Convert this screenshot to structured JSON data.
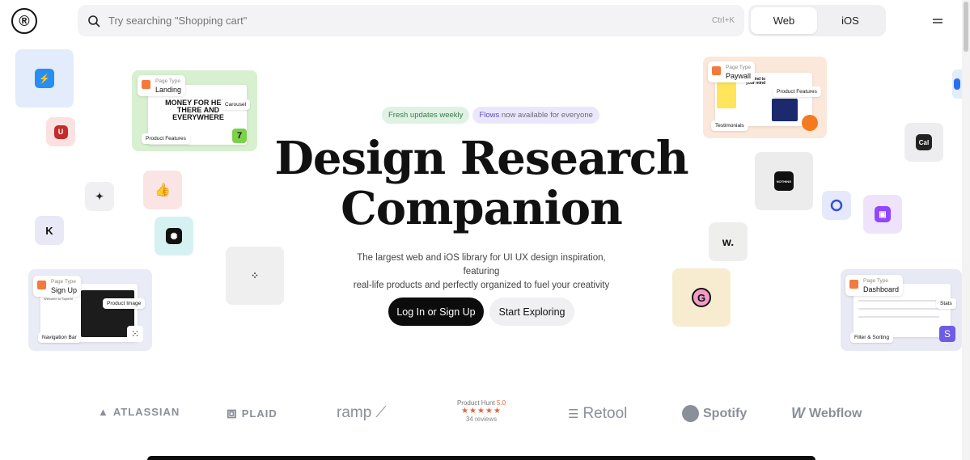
{
  "header": {
    "logo": "®",
    "search_placeholder": "Try searching \"Shopping cart\"",
    "search_shortcut": "Ctrl+K",
    "platform_tabs": [
      {
        "label": "Web",
        "active": true
      },
      {
        "label": "iOS",
        "active": false
      }
    ]
  },
  "hero": {
    "pill_updates": "Fresh updates weekly",
    "pill_flows_highlight": "Flows",
    "pill_flows_rest": " now available for everyone",
    "title_line1": "Design Research",
    "title_line2": "Companion",
    "subtitle_line1": "The largest web and iOS library for UI UX design inspiration, featuring",
    "subtitle_line2": "real-life products and perfectly organized to fuel your creativity",
    "primary_cta": "Log In or Sign Up",
    "secondary_cta": "Start Exploring"
  },
  "cards": {
    "landing": {
      "type_label": "Page Type",
      "type_value": "Landing",
      "headline": "MONEY FOR HERE THERE AND EVERYWHERE",
      "chip1": "Carousel",
      "chip2": "Product Features"
    },
    "paywall": {
      "type_label": "Page Type",
      "type_value": "Paywall",
      "chip1": "Product Features",
      "chip2": "Testimonials",
      "snippet": "Be kind to your mind"
    },
    "signup": {
      "type_label": "Page Type",
      "type_value": "Sign Up",
      "chip1": "Product Image",
      "chip2": "Navigation Bar",
      "snippet": "Welcome to Superhi"
    },
    "dashboard": {
      "type_label": "Page Type",
      "type_value": "Dashboard",
      "chip1": "Stats",
      "chip2": "Filter & Sorting"
    }
  },
  "tiles": {
    "cal": "Cal",
    "w": "w.",
    "g": "G",
    "k": "K",
    "nothing": "NOTHING"
  },
  "logos": {
    "atlassian": "ATLASSIAN",
    "plaid": "PLAID",
    "ramp": "ramp",
    "product_hunt_label": "Product Hunt",
    "product_hunt_score": "5.0",
    "product_hunt_stars": "★★★★★",
    "product_hunt_reviews": "34 reviews",
    "retool": "Retool",
    "spotify": "Spotify",
    "webflow": "Webflow"
  },
  "colors": {
    "accent_dark": "#0c0c0c",
    "green_pill": "#dff2e4",
    "purple_pill": "#ebe7fb",
    "producthunt": "#e8623a"
  }
}
